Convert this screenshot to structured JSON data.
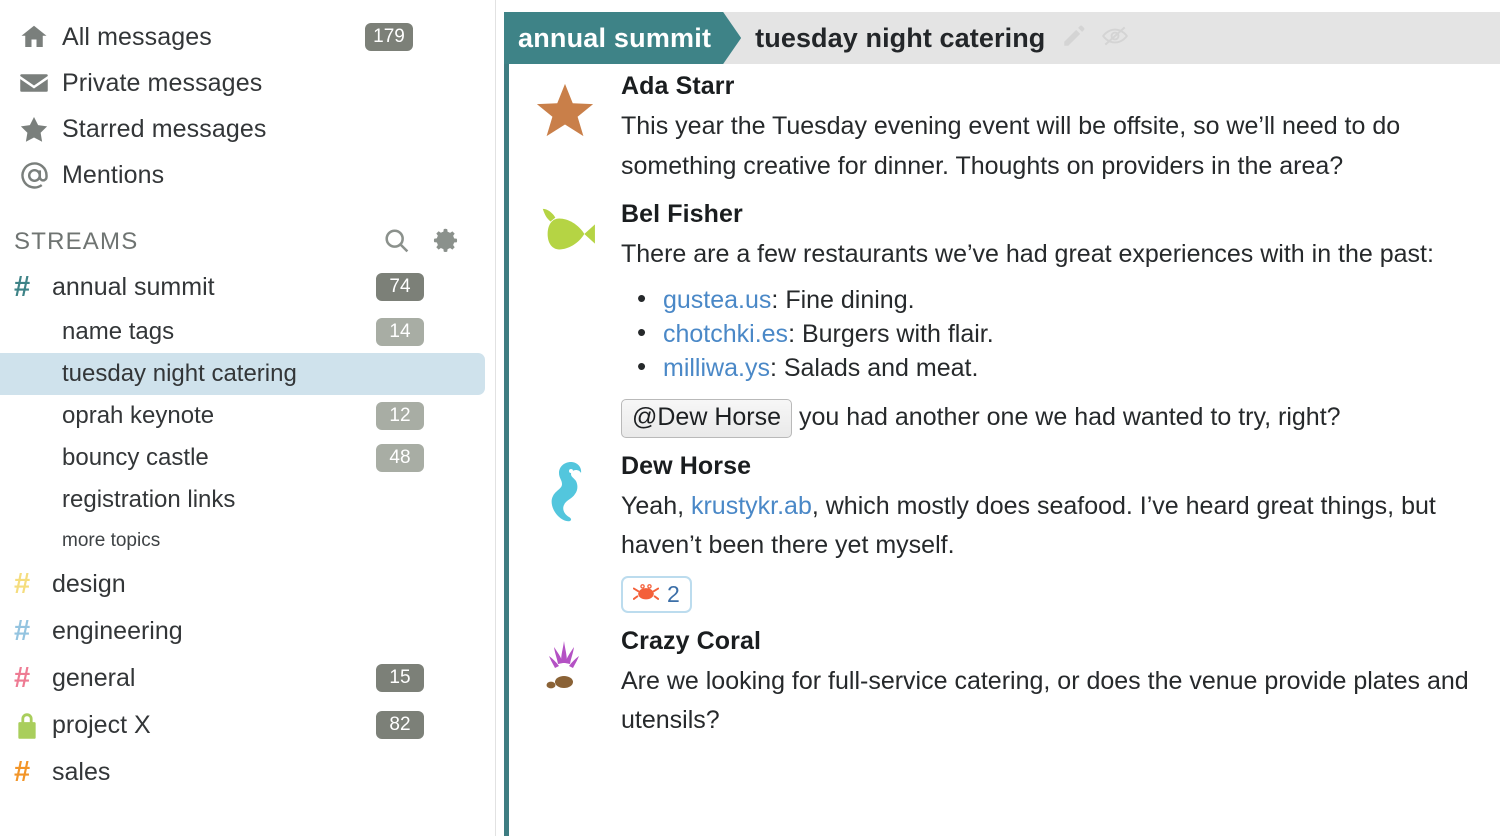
{
  "sidebar": {
    "nav": [
      {
        "icon": "home-icon",
        "label": "All messages",
        "count": "179"
      },
      {
        "icon": "envelope-icon",
        "label": "Private messages",
        "count": ""
      },
      {
        "icon": "star-icon",
        "label": "Starred messages",
        "count": ""
      },
      {
        "icon": "at-icon",
        "label": "Mentions",
        "count": ""
      }
    ],
    "streams_header": {
      "title": "STREAMS",
      "search_icon": "search-icon",
      "settings_icon": "gear-icon"
    },
    "streams": [
      {
        "name": "annual summit",
        "count": "74",
        "hash_color": "#3e8387",
        "icon": "hash-icon",
        "topics": [
          {
            "name": "name tags",
            "count": "14",
            "selected": false
          },
          {
            "name": "tuesday night catering",
            "count": "",
            "selected": true
          },
          {
            "name": "oprah keynote",
            "count": "12",
            "selected": false
          },
          {
            "name": "bouncy castle",
            "count": "48",
            "selected": false
          },
          {
            "name": "registration links",
            "count": "",
            "selected": false
          }
        ],
        "more_topics_label": "more topics"
      },
      {
        "name": "design",
        "count": "",
        "hash_color": "#f5dd7e",
        "icon": "hash-icon",
        "topics": []
      },
      {
        "name": "engineering",
        "count": "",
        "hash_color": "#94c4e0",
        "icon": "hash-icon",
        "topics": []
      },
      {
        "name": "general",
        "count": "15",
        "hash_color": "#ee7b93",
        "icon": "hash-icon",
        "topics": []
      },
      {
        "name": "project X",
        "count": "82",
        "hash_color": "#a9ce5c",
        "icon": "lock-icon",
        "topics": []
      },
      {
        "name": "sales",
        "count": "",
        "hash_color": "#f29528",
        "icon": "hash-icon",
        "topics": []
      }
    ]
  },
  "header": {
    "stream": "annual summit",
    "topic": "tuesday night catering",
    "edit_icon": "pencil-icon",
    "mute_icon": "eye-slash-icon",
    "stream_color": "#3e8387"
  },
  "messages": [
    {
      "sender": "Ada Starr",
      "avatar": "starfish-emoji",
      "emoji": "⭐",
      "text": "This year the Tuesday evening event will be offsite, so we’ll need to do something creative for dinner. Thoughts on providers in the area?"
    },
    {
      "sender": "Bel Fisher",
      "avatar": "tropical-fish-emoji",
      "emoji": "🐟",
      "text": "There are a few restaurants we’ve had great experiences with in the past:",
      "list": [
        {
          "link": "gustea.us",
          "rest": ": Fine dining."
        },
        {
          "link": "chotchki.es",
          "rest": ": Burgers with flair."
        },
        {
          "link": "milliwa.ys",
          "rest": ": Salads and meat."
        }
      ],
      "mention": "@Dew Horse",
      "mention_rest": "you had another one we had wanted to try, right?"
    },
    {
      "sender": "Dew Horse",
      "avatar": "seahorse-emoji",
      "emoji": "🌊",
      "text_pre": "Yeah, ",
      "link": "krustykr.ab",
      "text_post": ", which mostly does seafood. I’ve heard great things, but haven’t been there yet myself.",
      "reaction": {
        "emoji": "🦀",
        "count": "2"
      }
    },
    {
      "sender": "Crazy Coral",
      "avatar": "coral-emoji",
      "emoji": "🪸",
      "text": "Are we looking for full-service catering, or does the venue provide plates and utensils?"
    }
  ]
}
